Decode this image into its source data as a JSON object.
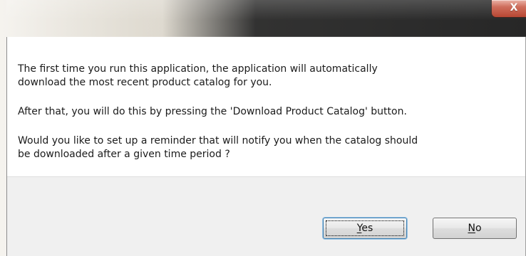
{
  "window": {
    "close_glyph": "X",
    "close_icon": "close-icon"
  },
  "message": {
    "paragraph_1": "The first time you run this application, the application will automatically\ndownload the most recent product catalog for you.",
    "paragraph_2": "After that, you will do this by pressing the 'Download Product Catalog' button.",
    "paragraph_3": "Would you like to set up a reminder that will notify you when the catalog should\nbe downloaded after a given time period ?"
  },
  "buttons": {
    "yes": {
      "mnemonic": "Y",
      "rest": "es"
    },
    "no": {
      "mnemonic": "N",
      "rest": "o"
    }
  }
}
